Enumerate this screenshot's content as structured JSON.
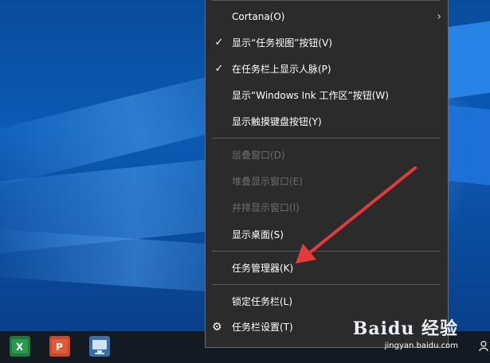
{
  "menu": {
    "items": [
      {
        "label": "Cortana(O)",
        "checked": false,
        "disabled": false,
        "submenu": true
      },
      {
        "label": "显示“任务视图”按钮(V)",
        "checked": true,
        "disabled": false
      },
      {
        "label": "在任务栏上显示人脉(P)",
        "checked": true,
        "disabled": false
      },
      {
        "label": "显示“Windows Ink 工作区”按钮(W)",
        "checked": false,
        "disabled": false
      },
      {
        "label": "显示触摸键盘按钮(Y)",
        "checked": false,
        "disabled": false
      },
      {
        "label": "层叠窗口(D)",
        "checked": false,
        "disabled": true
      },
      {
        "label": "堆叠显示窗口(E)",
        "checked": false,
        "disabled": true
      },
      {
        "label": "并排显示窗口(I)",
        "checked": false,
        "disabled": true
      },
      {
        "label": "显示桌面(S)",
        "checked": false,
        "disabled": false
      },
      {
        "label": "任务管理器(K)",
        "checked": false,
        "disabled": false
      },
      {
        "label": "锁定任务栏(L)",
        "checked": false,
        "disabled": false
      },
      {
        "label": "任务栏设置(T)",
        "checked": false,
        "disabled": false,
        "icon": "gear-icon"
      }
    ]
  },
  "icons": {
    "check": "✓",
    "chevron": "›",
    "gear": "⚙"
  },
  "taskbar": {
    "apps": [
      {
        "name": "excel-icon",
        "color": "#1d7a3e"
      },
      {
        "name": "powerpoint-icon",
        "color": "#c9472a"
      },
      {
        "name": "remote-desktop-icon",
        "color": "#5b8fc7"
      }
    ]
  },
  "watermark": {
    "logo": "Baidu 经验",
    "url": "jingyan.baidu.com"
  },
  "colors": {
    "menu_bg": "#2b2b2b",
    "menu_text": "#ffffff",
    "disabled_text": "#6d6d6d",
    "arrow": "#e33b3b",
    "taskbar": "#141a22"
  }
}
